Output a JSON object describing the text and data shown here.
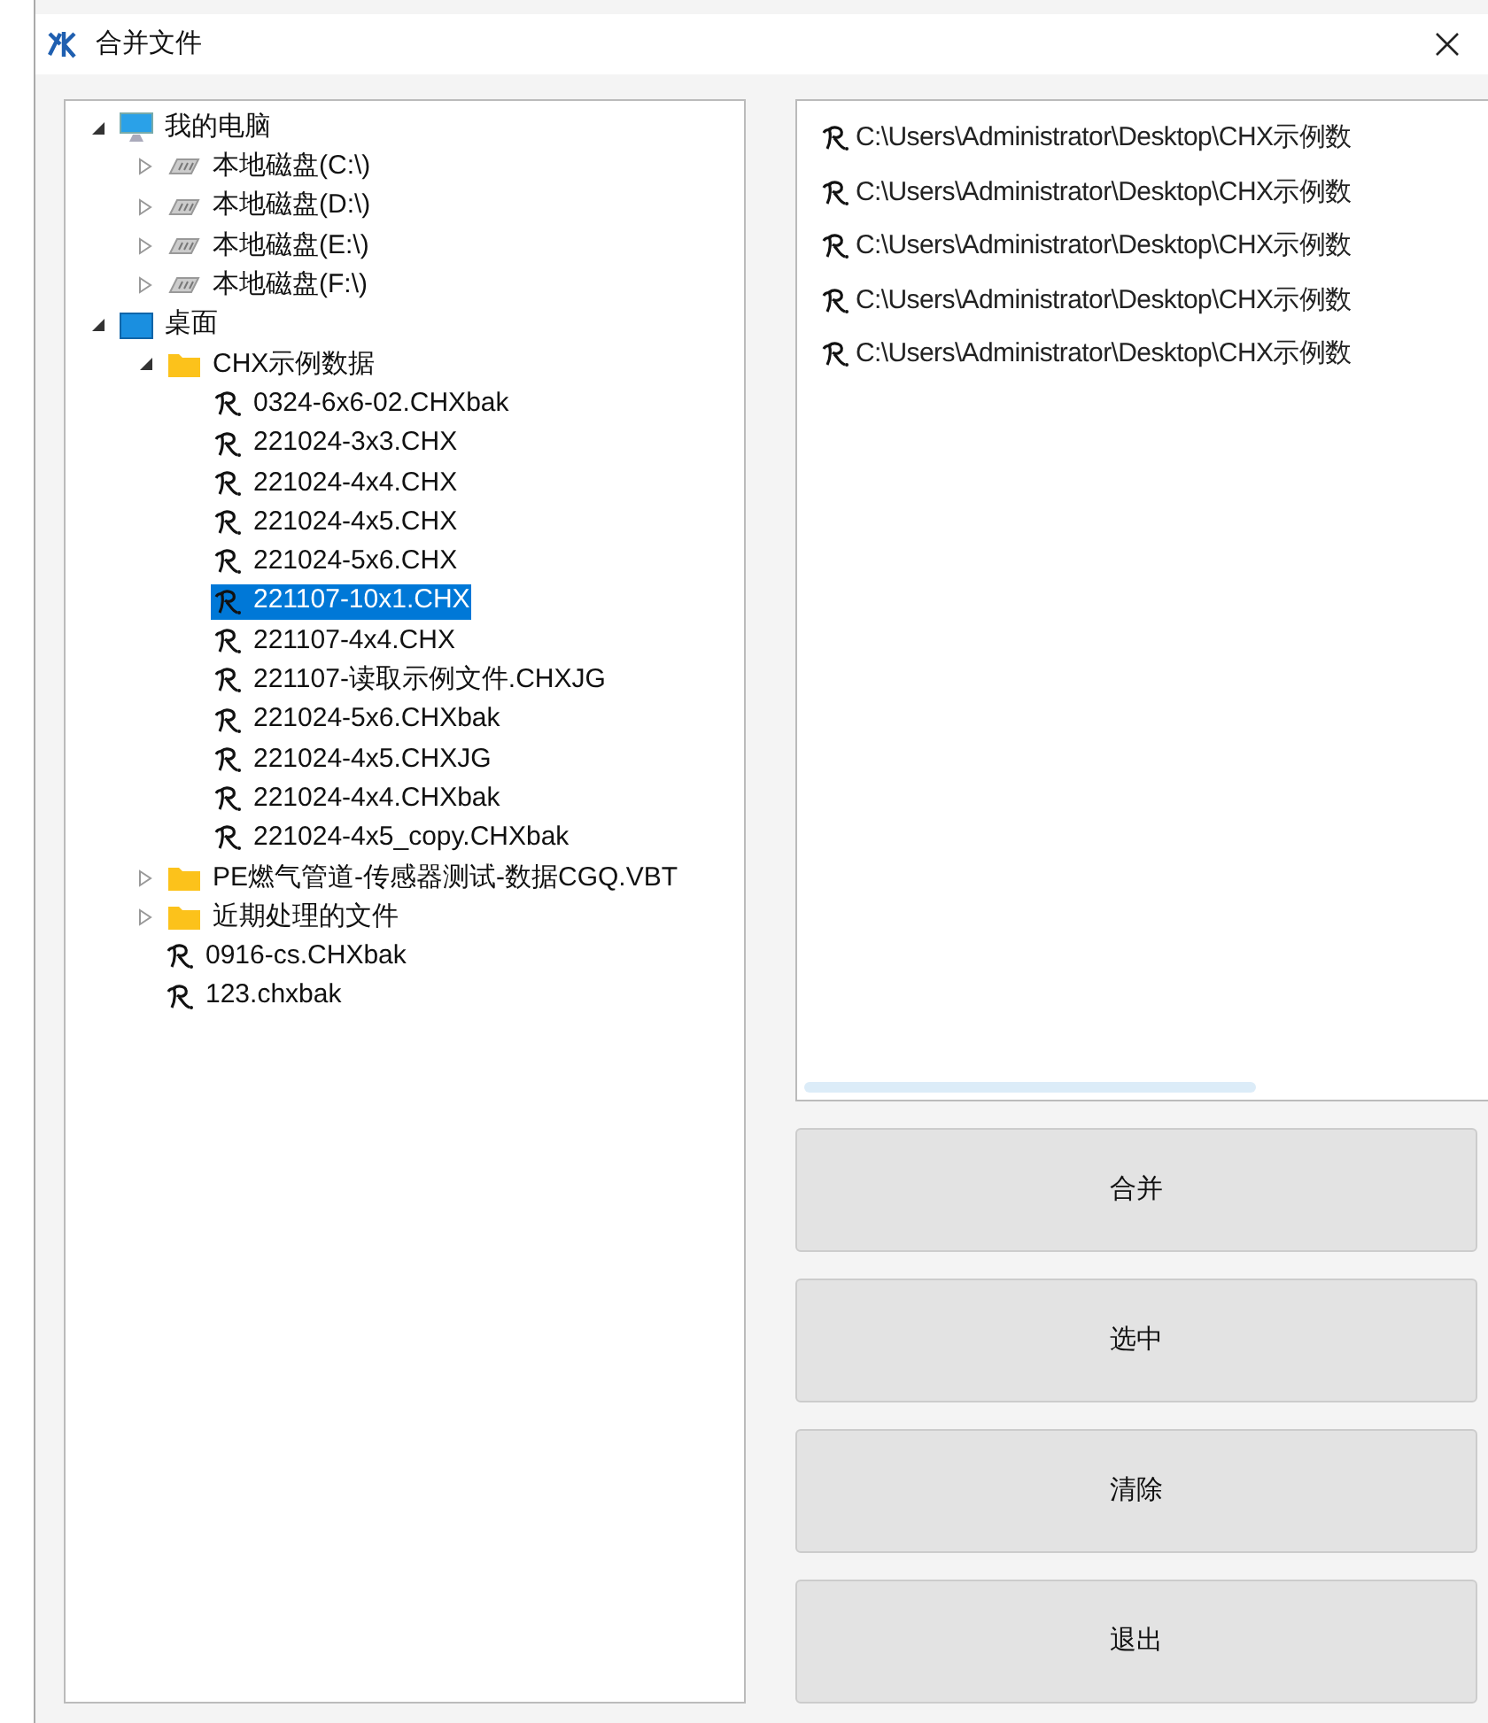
{
  "window": {
    "title": "合并文件"
  },
  "tree": [
    {
      "label": "我的电脑",
      "kind": "computer",
      "expanded": true,
      "selected": false,
      "children": [
        {
          "label": "本地磁盘(C:\\)",
          "kind": "drive",
          "expanded": false,
          "selected": false
        },
        {
          "label": "本地磁盘(D:\\)",
          "kind": "drive",
          "expanded": false,
          "selected": false
        },
        {
          "label": "本地磁盘(E:\\)",
          "kind": "drive",
          "expanded": false,
          "selected": false
        },
        {
          "label": "本地磁盘(F:\\)",
          "kind": "drive",
          "expanded": false,
          "selected": false
        }
      ]
    },
    {
      "label": "桌面",
      "kind": "desktop",
      "expanded": true,
      "selected": false,
      "children": [
        {
          "label": "CHX示例数据",
          "kind": "folder",
          "expanded": true,
          "selected": false,
          "children": [
            {
              "label": "0324-6x6-02.CHXbak",
              "kind": "file",
              "selected": false
            },
            {
              "label": "221024-3x3.CHX",
              "kind": "file",
              "selected": false
            },
            {
              "label": "221024-4x4.CHX",
              "kind": "file",
              "selected": false
            },
            {
              "label": "221024-4x5.CHX",
              "kind": "file",
              "selected": false
            },
            {
              "label": "221024-5x6.CHX",
              "kind": "file",
              "selected": false
            },
            {
              "label": "221107-10x1.CHX",
              "kind": "file",
              "selected": true
            },
            {
              "label": "221107-4x4.CHX",
              "kind": "file",
              "selected": false
            },
            {
              "label": "221107-读取示例文件.CHXJG",
              "kind": "file",
              "selected": false
            },
            {
              "label": "221024-5x6.CHXbak",
              "kind": "file",
              "selected": false
            },
            {
              "label": "221024-4x5.CHXJG",
              "kind": "file",
              "selected": false
            },
            {
              "label": "221024-4x4.CHXbak",
              "kind": "file",
              "selected": false
            },
            {
              "label": "221024-4x5_copy.CHXbak",
              "kind": "file",
              "selected": false
            }
          ]
        },
        {
          "label": "PE燃气管道-传感器测试-数据CGQ.VBT",
          "kind": "folder",
          "expanded": false,
          "selected": false
        },
        {
          "label": "近期处理的文件",
          "kind": "folder",
          "expanded": false,
          "selected": false
        },
        {
          "label": "0916-cs.CHXbak",
          "kind": "file",
          "selected": false
        },
        {
          "label": "123.chxbak",
          "kind": "file",
          "selected": false
        }
      ]
    }
  ],
  "file_list": [
    "C:\\Users\\Administrator\\Desktop\\CHX示例数",
    "C:\\Users\\Administrator\\Desktop\\CHX示例数",
    "C:\\Users\\Administrator\\Desktop\\CHX示例数",
    "C:\\Users\\Administrator\\Desktop\\CHX示例数",
    "C:\\Users\\Administrator\\Desktop\\CHX示例数"
  ],
  "buttons": [
    "合并",
    "选中",
    "清除",
    "退出"
  ]
}
